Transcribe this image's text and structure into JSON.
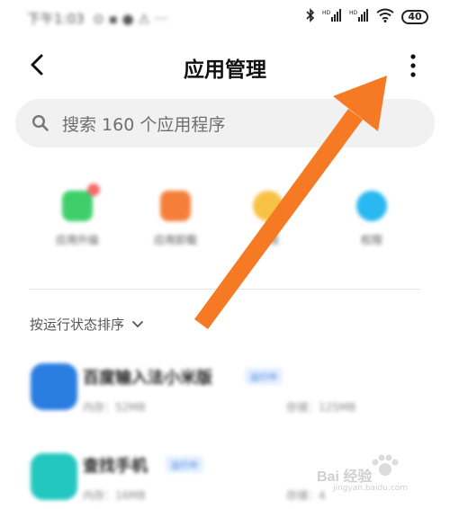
{
  "status_bar": {
    "time_and_icons": "下午1:03",
    "battery": "40"
  },
  "header": {
    "title": "应用管理"
  },
  "search": {
    "placeholder": "搜索 160 个应用程序"
  },
  "quick_actions": [
    {
      "label": "应用升级",
      "color": "#3ecf6b"
    },
    {
      "label": "应用卸载",
      "color": "#f57f3a"
    },
    {
      "label": "权限",
      "color": "#f7c144"
    },
    {
      "label": "权限",
      "color": "#29b8f0"
    }
  ],
  "sort": {
    "label": "按运行状态排序"
  },
  "apps": [
    {
      "name": "百度输入法小米版",
      "tag": "运行中",
      "memory": "内存：52MB",
      "storage": "存储：125MB",
      "color": "#2a7de1"
    },
    {
      "name": "查找手机",
      "tag": "运行中",
      "memory": "内存：16MB",
      "storage": "存储：4",
      "color": "#22c7bf"
    }
  ],
  "watermark": {
    "text": "Bai 经验",
    "sub": "jingyan.baidu.com"
  },
  "colors": {
    "arrow": "#f57a23"
  }
}
